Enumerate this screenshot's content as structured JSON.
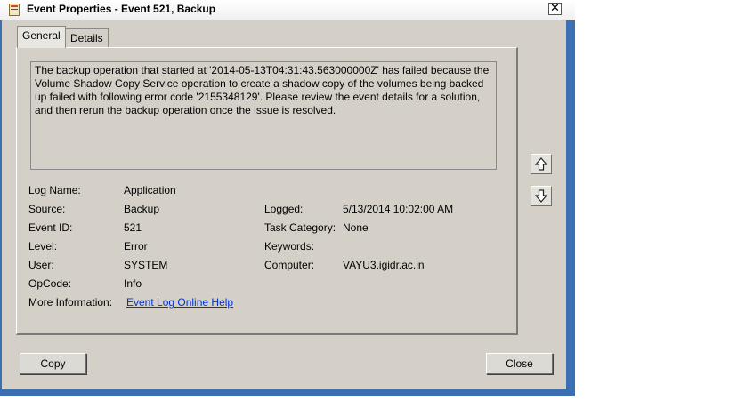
{
  "window": {
    "title": "Event Properties - Event 521, Backup"
  },
  "tabs": [
    {
      "label": "General"
    },
    {
      "label": "Details"
    }
  ],
  "description": "The backup operation that started at '2014-05-13T04:31:43.563000000Z' has failed because the Volume Shadow Copy Service operation to create a shadow copy of the volumes being backed up failed with following error code '2155348129'. Please review the event details for a solution, and then rerun the backup operation once the issue is resolved.",
  "fields": {
    "log_name_label": "Log Name:",
    "log_name": "Application",
    "source_label": "Source:",
    "source": "Backup",
    "logged_label": "Logged:",
    "logged": "5/13/2014 10:02:00 AM",
    "event_id_label": "Event ID:",
    "event_id": "521",
    "task_category_label": "Task Category:",
    "task_category": "None",
    "level_label": "Level:",
    "level": "Error",
    "keywords_label": "Keywords:",
    "keywords": "",
    "user_label": "User:",
    "user": "SYSTEM",
    "computer_label": "Computer:",
    "computer": "VAYU3.igidr.ac.in",
    "opcode_label": "OpCode:",
    "opcode": "Info",
    "more_info_label": "More Information:",
    "more_info_link": "Event Log Online Help"
  },
  "buttons": {
    "copy": "Copy",
    "close": "Close"
  },
  "icons": {
    "window_icon": "event-viewer-icon",
    "close": "close-icon",
    "up": "arrow-up-icon",
    "down": "arrow-down-icon"
  }
}
